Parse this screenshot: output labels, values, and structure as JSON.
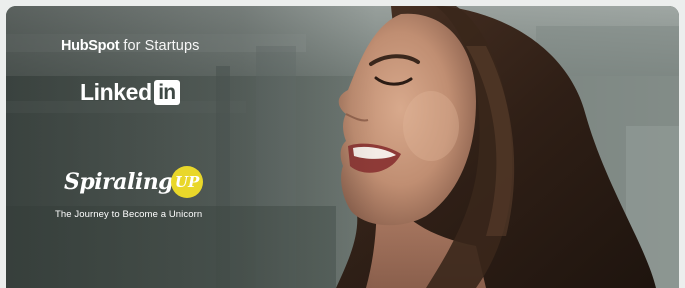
{
  "banner": {
    "hubspot": {
      "name": "HubSpot",
      "suffix": "for Startups"
    },
    "linkedin": {
      "word": "Linked",
      "box": "in"
    },
    "spiraling_up": {
      "word": "Spiraling",
      "badge": "UP",
      "badge_color": "#e9d72a"
    },
    "tagline": "The Journey to Become a Unicorn",
    "photo": "smiling-woman-looking-up"
  }
}
